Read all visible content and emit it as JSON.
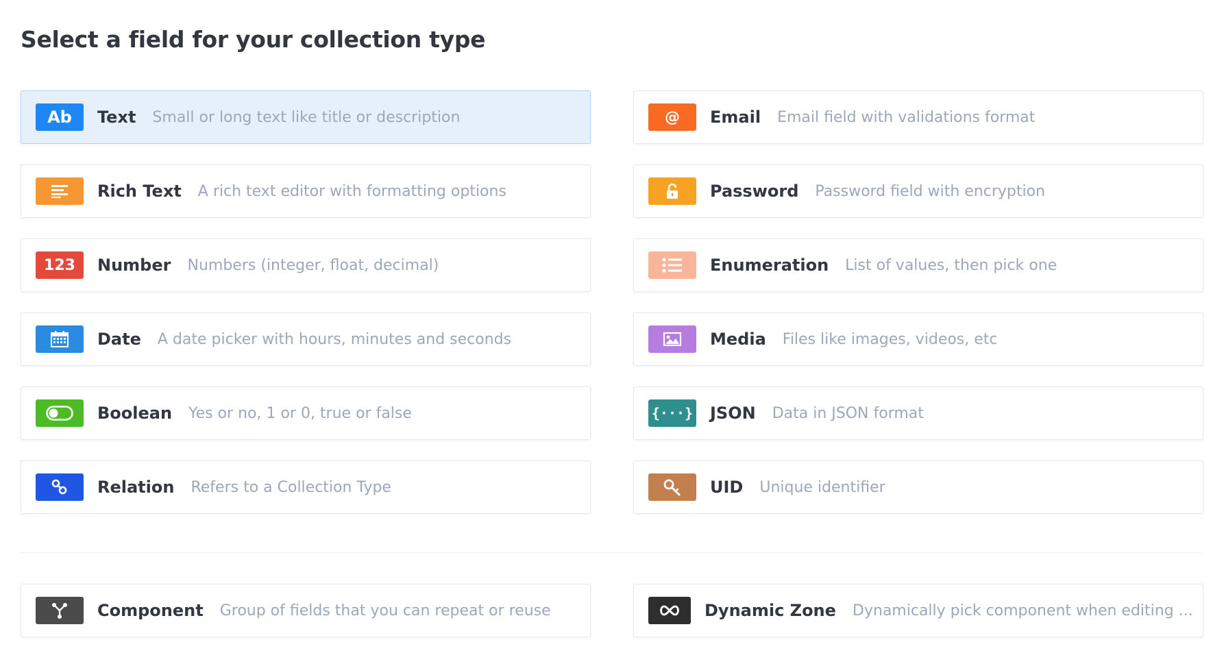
{
  "page_title": "Select a field for your collection type",
  "fields": [
    {
      "key": "text",
      "label": "Text",
      "description": "Small or long text like title or description",
      "badge_text": "Ab",
      "icon": "text-icon",
      "color": "#1c87f5",
      "active": true
    },
    {
      "key": "email",
      "label": "Email",
      "description": "Email field with validations format",
      "badge_text": "@",
      "icon": "at-icon",
      "color": "#f96b24"
    },
    {
      "key": "richtext",
      "label": "Rich Text",
      "description": "A rich text editor with formatting options",
      "icon": "align-left-icon",
      "color": "#f69733"
    },
    {
      "key": "password",
      "label": "Password",
      "description": "Password field with encryption",
      "icon": "unlock-icon",
      "color": "#f8a224"
    },
    {
      "key": "number",
      "label": "Number",
      "description": "Numbers (integer, float, decimal)",
      "badge_text": "123",
      "icon": "number-icon",
      "color": "#e44a3c"
    },
    {
      "key": "enumeration",
      "label": "Enumeration",
      "description": "List of values, then pick one",
      "icon": "list-icon",
      "color": "#f9b59a"
    },
    {
      "key": "date",
      "label": "Date",
      "description": "A date picker with hours, minutes and seconds",
      "icon": "calendar-icon",
      "color": "#2b8be1"
    },
    {
      "key": "media",
      "label": "Media",
      "description": "Files like images, videos, etc",
      "icon": "image-icon",
      "color": "#b57de0"
    },
    {
      "key": "boolean",
      "label": "Boolean",
      "description": "Yes or no, 1 or 0, true or false",
      "icon": "toggle-icon",
      "color": "#4cbb24"
    },
    {
      "key": "json",
      "label": "JSON",
      "description": "Data in JSON format",
      "badge_text": "{···}",
      "icon": "braces-icon",
      "color": "#2f8e8e"
    },
    {
      "key": "relation",
      "label": "Relation",
      "description": "Refers to a Collection Type",
      "icon": "link-icon",
      "color": "#1f56e4"
    },
    {
      "key": "uid",
      "label": "UID",
      "description": "Unique identifier",
      "icon": "key-icon",
      "color": "#c47f4e"
    }
  ],
  "special_fields": [
    {
      "key": "component",
      "label": "Component",
      "description": "Group of fields that you can repeat or reuse",
      "icon": "component-icon",
      "color": "#4b4b4b"
    },
    {
      "key": "dynamiczone",
      "label": "Dynamic Zone",
      "description": "Dynamically pick component when editing ...",
      "icon": "infinity-icon",
      "color": "#2e2e2e"
    }
  ]
}
